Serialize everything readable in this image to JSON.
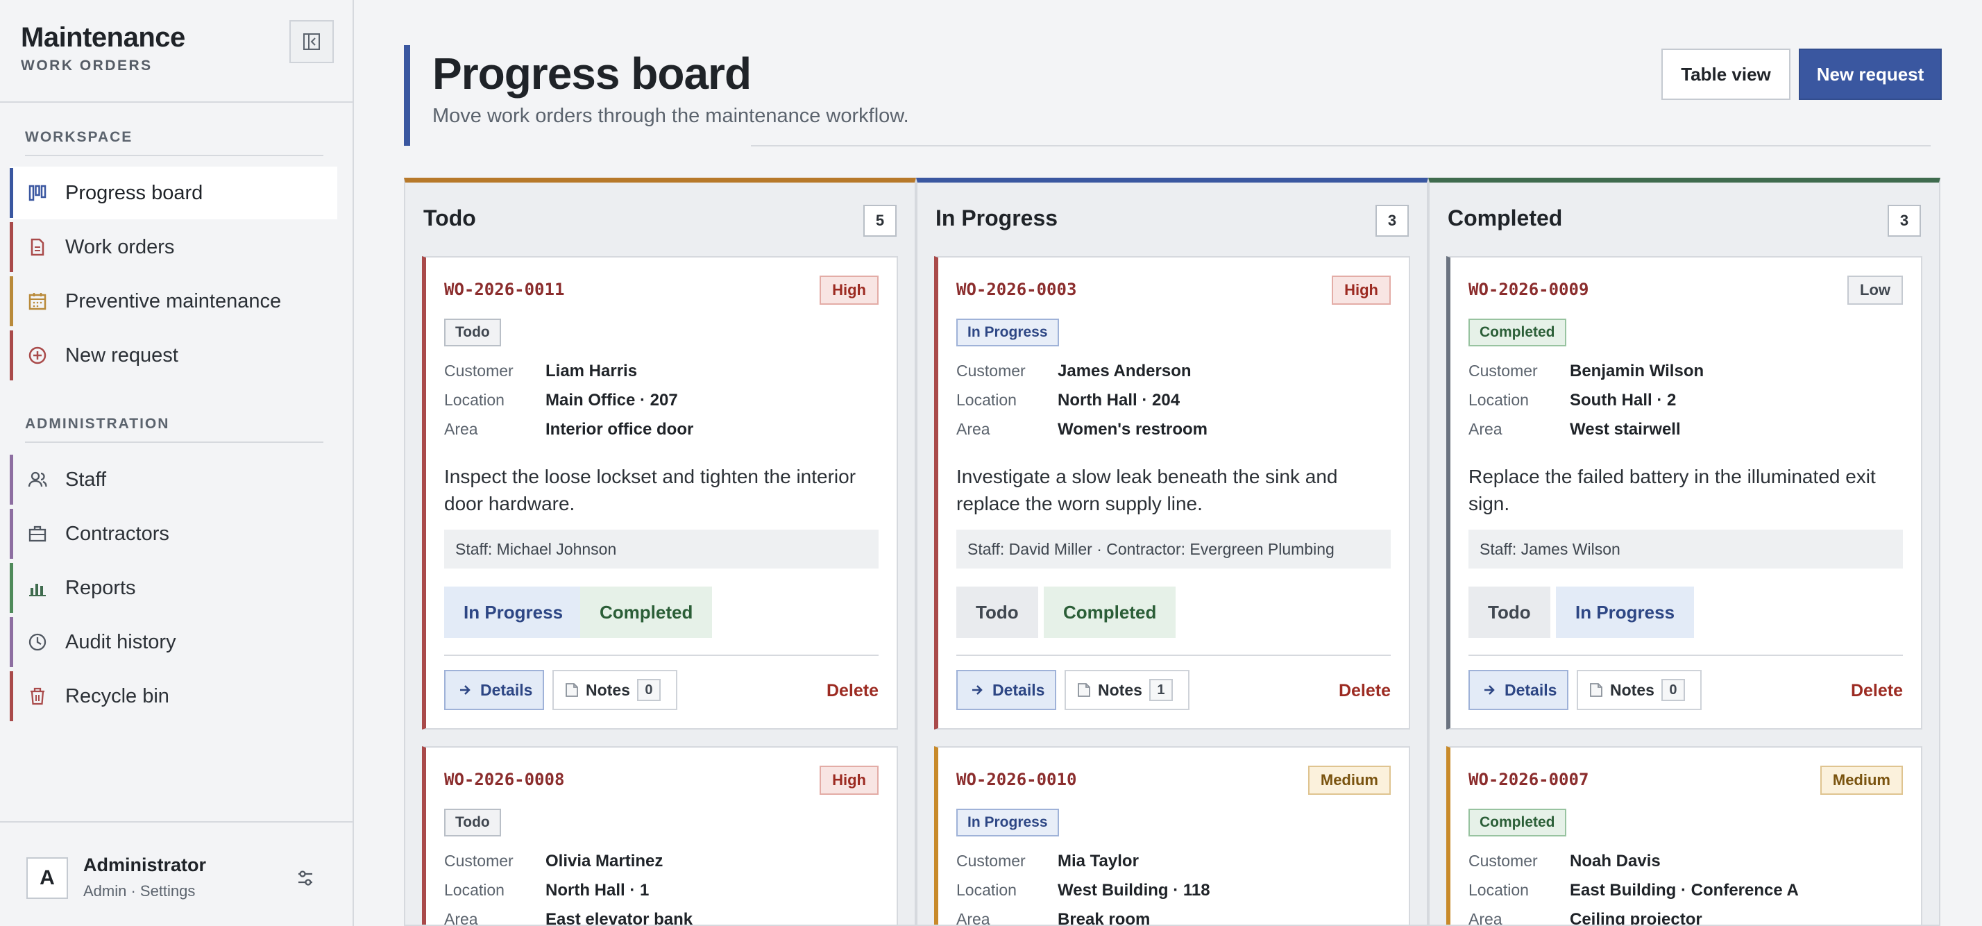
{
  "sidebar": {
    "brand_title": "Maintenance",
    "brand_subtitle": "WORK ORDERS",
    "section_workspace": "WORKSPACE",
    "section_admin": "ADMINISTRATION",
    "workspace_items": [
      {
        "label": "Progress board",
        "icon": "kanban-icon",
        "accent": "#3a57a0",
        "active": true
      },
      {
        "label": "Work orders",
        "icon": "document-icon",
        "accent": "#a94a4a"
      },
      {
        "label": "Preventive maintenance",
        "icon": "calendar-icon",
        "accent": "#b98a3a"
      },
      {
        "label": "New request",
        "icon": "plus-circle-icon",
        "accent": "#a94a4a"
      }
    ],
    "admin_items": [
      {
        "label": "Staff",
        "icon": "users-icon",
        "accent": "#8d6ea1"
      },
      {
        "label": "Contractors",
        "icon": "briefcase-icon",
        "accent": "#8d6ea1"
      },
      {
        "label": "Reports",
        "icon": "bar-chart-icon",
        "accent": "#4f8a5a"
      },
      {
        "label": "Audit history",
        "icon": "clock-icon",
        "accent": "#8d6ea1"
      },
      {
        "label": "Recycle bin",
        "icon": "trash-icon",
        "accent": "#a94a4a"
      }
    ],
    "user": {
      "initial": "A",
      "name": "Administrator",
      "subtitle": "Admin · Settings"
    }
  },
  "header": {
    "title": "Progress board",
    "subtitle": "Move work orders through the maintenance workflow.",
    "table_view_label": "Table view",
    "new_request_label": "New request"
  },
  "labels": {
    "customer": "Customer",
    "location": "Location",
    "area": "Area",
    "details": "Details",
    "notes": "Notes",
    "delete": "Delete"
  },
  "colors": {
    "accent": "#3a57a0",
    "todo": "#b7792a",
    "inprogress": "#3a57a0",
    "completed": "#3f6b4e",
    "high": "#9c2b22",
    "medium": "#c88a2a",
    "low": "#6b7380"
  },
  "columns": [
    {
      "title": "Todo",
      "count": "5",
      "cards": [
        {
          "id": "WO-2026-0011",
          "priority": "High",
          "status": "Todo",
          "customer": "Liam Harris",
          "location": "Main Office · 207",
          "area": "Interior office door",
          "description": "Inspect the loose lockset and tighten the interior door hardware.",
          "staff": "Staff: Michael Johnson",
          "actions": [
            "In Progress",
            "Completed"
          ],
          "notes": "0"
        },
        {
          "id": "WO-2026-0008",
          "priority": "High",
          "status": "Todo",
          "customer": "Olivia Martinez",
          "location": "North Hall · 1",
          "area": "East elevator bank"
        }
      ]
    },
    {
      "title": "In Progress",
      "count": "3",
      "cards": [
        {
          "id": "WO-2026-0003",
          "priority": "High",
          "status": "In Progress",
          "customer": "James Anderson",
          "location": "North Hall · 204",
          "area": "Women's restroom",
          "description": "Investigate a slow leak beneath the sink and replace the worn supply line.",
          "staff": "Staff: David Miller · Contractor: Evergreen Plumbing",
          "actions": [
            "Todo",
            "Completed"
          ],
          "notes": "1"
        },
        {
          "id": "WO-2026-0010",
          "priority": "Medium",
          "status": "In Progress",
          "customer": "Mia Taylor",
          "location": "West Building · 118",
          "area": "Break room"
        }
      ]
    },
    {
      "title": "Completed",
      "count": "3",
      "cards": [
        {
          "id": "WO-2026-0009",
          "priority": "Low",
          "status": "Completed",
          "customer": "Benjamin Wilson",
          "location": "South Hall · 2",
          "area": "West stairwell",
          "description": "Replace the failed battery in the illuminated exit sign.",
          "staff": "Staff: James Wilson",
          "actions": [
            "Todo",
            "In Progress"
          ],
          "notes": "0"
        },
        {
          "id": "WO-2026-0007",
          "priority": "Medium",
          "status": "Completed",
          "customer": "Noah Davis",
          "location": "East Building · Conference A",
          "area": "Ceiling projector"
        }
      ]
    }
  ]
}
